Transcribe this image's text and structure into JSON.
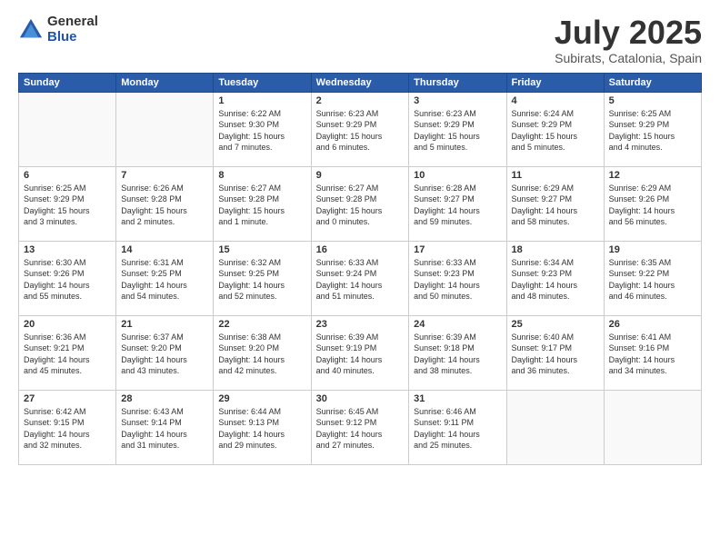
{
  "logo": {
    "general": "General",
    "blue": "Blue"
  },
  "title": "July 2025",
  "subtitle": "Subirats, Catalonia, Spain",
  "header_days": [
    "Sunday",
    "Monday",
    "Tuesday",
    "Wednesday",
    "Thursday",
    "Friday",
    "Saturday"
  ],
  "weeks": [
    [
      {
        "day": "",
        "info": ""
      },
      {
        "day": "",
        "info": ""
      },
      {
        "day": "1",
        "info": "Sunrise: 6:22 AM\nSunset: 9:30 PM\nDaylight: 15 hours\nand 7 minutes."
      },
      {
        "day": "2",
        "info": "Sunrise: 6:23 AM\nSunset: 9:29 PM\nDaylight: 15 hours\nand 6 minutes."
      },
      {
        "day": "3",
        "info": "Sunrise: 6:23 AM\nSunset: 9:29 PM\nDaylight: 15 hours\nand 5 minutes."
      },
      {
        "day": "4",
        "info": "Sunrise: 6:24 AM\nSunset: 9:29 PM\nDaylight: 15 hours\nand 5 minutes."
      },
      {
        "day": "5",
        "info": "Sunrise: 6:25 AM\nSunset: 9:29 PM\nDaylight: 15 hours\nand 4 minutes."
      }
    ],
    [
      {
        "day": "6",
        "info": "Sunrise: 6:25 AM\nSunset: 9:29 PM\nDaylight: 15 hours\nand 3 minutes."
      },
      {
        "day": "7",
        "info": "Sunrise: 6:26 AM\nSunset: 9:28 PM\nDaylight: 15 hours\nand 2 minutes."
      },
      {
        "day": "8",
        "info": "Sunrise: 6:27 AM\nSunset: 9:28 PM\nDaylight: 15 hours\nand 1 minute."
      },
      {
        "day": "9",
        "info": "Sunrise: 6:27 AM\nSunset: 9:28 PM\nDaylight: 15 hours\nand 0 minutes."
      },
      {
        "day": "10",
        "info": "Sunrise: 6:28 AM\nSunset: 9:27 PM\nDaylight: 14 hours\nand 59 minutes."
      },
      {
        "day": "11",
        "info": "Sunrise: 6:29 AM\nSunset: 9:27 PM\nDaylight: 14 hours\nand 58 minutes."
      },
      {
        "day": "12",
        "info": "Sunrise: 6:29 AM\nSunset: 9:26 PM\nDaylight: 14 hours\nand 56 minutes."
      }
    ],
    [
      {
        "day": "13",
        "info": "Sunrise: 6:30 AM\nSunset: 9:26 PM\nDaylight: 14 hours\nand 55 minutes."
      },
      {
        "day": "14",
        "info": "Sunrise: 6:31 AM\nSunset: 9:25 PM\nDaylight: 14 hours\nand 54 minutes."
      },
      {
        "day": "15",
        "info": "Sunrise: 6:32 AM\nSunset: 9:25 PM\nDaylight: 14 hours\nand 52 minutes."
      },
      {
        "day": "16",
        "info": "Sunrise: 6:33 AM\nSunset: 9:24 PM\nDaylight: 14 hours\nand 51 minutes."
      },
      {
        "day": "17",
        "info": "Sunrise: 6:33 AM\nSunset: 9:23 PM\nDaylight: 14 hours\nand 50 minutes."
      },
      {
        "day": "18",
        "info": "Sunrise: 6:34 AM\nSunset: 9:23 PM\nDaylight: 14 hours\nand 48 minutes."
      },
      {
        "day": "19",
        "info": "Sunrise: 6:35 AM\nSunset: 9:22 PM\nDaylight: 14 hours\nand 46 minutes."
      }
    ],
    [
      {
        "day": "20",
        "info": "Sunrise: 6:36 AM\nSunset: 9:21 PM\nDaylight: 14 hours\nand 45 minutes."
      },
      {
        "day": "21",
        "info": "Sunrise: 6:37 AM\nSunset: 9:20 PM\nDaylight: 14 hours\nand 43 minutes."
      },
      {
        "day": "22",
        "info": "Sunrise: 6:38 AM\nSunset: 9:20 PM\nDaylight: 14 hours\nand 42 minutes."
      },
      {
        "day": "23",
        "info": "Sunrise: 6:39 AM\nSunset: 9:19 PM\nDaylight: 14 hours\nand 40 minutes."
      },
      {
        "day": "24",
        "info": "Sunrise: 6:39 AM\nSunset: 9:18 PM\nDaylight: 14 hours\nand 38 minutes."
      },
      {
        "day": "25",
        "info": "Sunrise: 6:40 AM\nSunset: 9:17 PM\nDaylight: 14 hours\nand 36 minutes."
      },
      {
        "day": "26",
        "info": "Sunrise: 6:41 AM\nSunset: 9:16 PM\nDaylight: 14 hours\nand 34 minutes."
      }
    ],
    [
      {
        "day": "27",
        "info": "Sunrise: 6:42 AM\nSunset: 9:15 PM\nDaylight: 14 hours\nand 32 minutes."
      },
      {
        "day": "28",
        "info": "Sunrise: 6:43 AM\nSunset: 9:14 PM\nDaylight: 14 hours\nand 31 minutes."
      },
      {
        "day": "29",
        "info": "Sunrise: 6:44 AM\nSunset: 9:13 PM\nDaylight: 14 hours\nand 29 minutes."
      },
      {
        "day": "30",
        "info": "Sunrise: 6:45 AM\nSunset: 9:12 PM\nDaylight: 14 hours\nand 27 minutes."
      },
      {
        "day": "31",
        "info": "Sunrise: 6:46 AM\nSunset: 9:11 PM\nDaylight: 14 hours\nand 25 minutes."
      },
      {
        "day": "",
        "info": ""
      },
      {
        "day": "",
        "info": ""
      }
    ]
  ]
}
